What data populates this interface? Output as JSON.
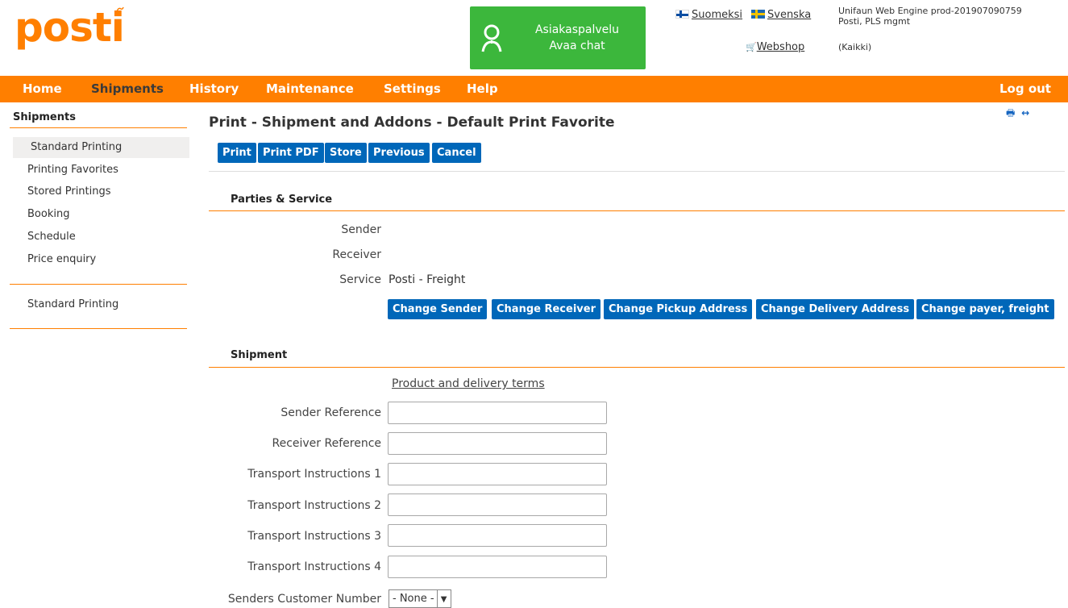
{
  "brand": {
    "logo": "posti"
  },
  "chat": {
    "line1": "Asiakaspalvelu",
    "line2": "Avaa chat"
  },
  "languages": [
    {
      "label": "Suomeksi"
    },
    {
      "label": "Svenska"
    }
  ],
  "webshop": "Webshop",
  "env": {
    "line1": "Unifaun Web Engine prod-201907090759",
    "line2": "Posti, PLS mgmt",
    "scope": "(Kaikki)"
  },
  "nav": {
    "items": [
      {
        "label": "Home"
      },
      {
        "label": "Shipments"
      },
      {
        "label": "History"
      },
      {
        "label": "Maintenance"
      },
      {
        "label": "Settings"
      },
      {
        "label": "Help"
      }
    ],
    "logout": "Log out"
  },
  "sidebar": {
    "title": "Shipments",
    "items": [
      {
        "label": "Standard Printing"
      },
      {
        "label": "Printing Favorites"
      },
      {
        "label": "Stored Printings"
      },
      {
        "label": "Booking"
      },
      {
        "label": "Schedule"
      },
      {
        "label": "Price enquiry"
      }
    ],
    "recent": [
      {
        "label": "Standard Printing"
      }
    ]
  },
  "page": {
    "title": "Print - Shipment and Addons  - Default Print Favorite",
    "actions": [
      {
        "label": "Print"
      },
      {
        "label": "Print PDF"
      },
      {
        "label": "Store"
      },
      {
        "label": "Previous"
      },
      {
        "label": "Cancel"
      }
    ]
  },
  "parties": {
    "section": "Parties & Service",
    "sender_label": "Sender",
    "receiver_label": "Receiver",
    "service_label": "Service",
    "service_value": "Posti - Freight",
    "buttons": [
      {
        "label": "Change Sender"
      },
      {
        "label": "Change Receiver"
      },
      {
        "label": "Change Pickup Address"
      },
      {
        "label": "Change Delivery Address"
      },
      {
        "label": "Change payer, freight"
      }
    ]
  },
  "shipment": {
    "section": "Shipment",
    "terms_link": "Product and delivery terms",
    "fields": [
      {
        "label": "Sender Reference",
        "value": ""
      },
      {
        "label": "Receiver Reference",
        "value": ""
      },
      {
        "label": "Transport Instructions 1",
        "value": ""
      },
      {
        "label": "Transport Instructions 2",
        "value": ""
      },
      {
        "label": "Transport Instructions 3",
        "value": ""
      },
      {
        "label": "Transport Instructions 4",
        "value": ""
      }
    ],
    "customer_number_label": "Senders Customer Number",
    "customer_number_value": "- None -"
  },
  "colors": {
    "brand_orange": "#ff7f00",
    "button_blue": "#0067b9",
    "chat_green": "#3cb73c"
  }
}
